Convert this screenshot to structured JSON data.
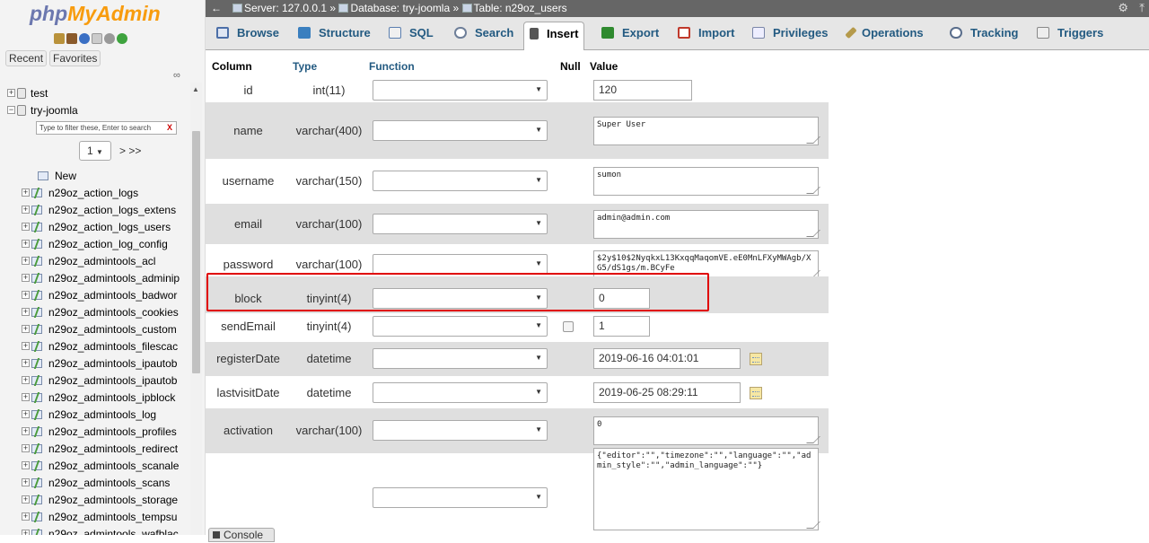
{
  "nav": {
    "logo_a": "php",
    "logo_b": "MyAdmin",
    "recent": "Recent",
    "favorites": "Favorites",
    "filter_placeholder": "Type to filter these, Enter to search",
    "filter_clear": "X",
    "page_value": "1",
    "page_next": "> >>",
    "new_label": "New",
    "databases": [
      "test",
      "try-joomla"
    ],
    "tables": [
      "n29oz_action_logs",
      "n29oz_action_logs_extens",
      "n29oz_action_logs_users",
      "n29oz_action_log_config",
      "n29oz_admintools_acl",
      "n29oz_admintools_adminip",
      "n29oz_admintools_badwor",
      "n29oz_admintools_cookies",
      "n29oz_admintools_custom",
      "n29oz_admintools_filescac",
      "n29oz_admintools_ipautob",
      "n29oz_admintools_ipautob",
      "n29oz_admintools_ipblock",
      "n29oz_admintools_log",
      "n29oz_admintools_profiles",
      "n29oz_admintools_redirect",
      "n29oz_admintools_scanale",
      "n29oz_admintools_scans",
      "n29oz_admintools_storage",
      "n29oz_admintools_tempsu",
      "n29oz_admintools_wafblac"
    ]
  },
  "topbar": {
    "back": "←",
    "server": "Server: 127.0.0.1",
    "sep": "»",
    "database": "Database: try-joomla",
    "table": "Table: n29oz_users"
  },
  "tabs": [
    {
      "label": "Browse",
      "color": "#4c6fa8"
    },
    {
      "label": "Structure",
      "color": "#3a7fbf"
    },
    {
      "label": "SQL",
      "color": "#5b7fb0"
    },
    {
      "label": "Search",
      "color": "#6e7f99"
    },
    {
      "label": "Insert",
      "color": "#333333"
    },
    {
      "label": "Export",
      "color": "#2f8a2f"
    },
    {
      "label": "Import",
      "color": "#c0392b"
    },
    {
      "label": "Privileges",
      "color": "#7a86a8"
    },
    {
      "label": "Operations",
      "color": "#b59a4b"
    },
    {
      "label": "Tracking",
      "color": "#5a6e8c"
    },
    {
      "label": "Triggers",
      "color": "#888888"
    }
  ],
  "form": {
    "headers": {
      "column": "Column",
      "type": "Type",
      "function": "Function",
      "null": "Null",
      "value": "Value"
    },
    "rows": [
      {
        "column": "id",
        "type": "int(11)",
        "value": "120"
      },
      {
        "column": "name",
        "type": "varchar(400)",
        "value": "Super User"
      },
      {
        "column": "username",
        "type": "varchar(150)",
        "value": "sumon"
      },
      {
        "column": "email",
        "type": "varchar(100)",
        "value": "admin@admin.com"
      },
      {
        "column": "password",
        "type": "varchar(100)",
        "value": "$2y$10$2NyqkxL13KxqqMaqomVE.eE0MnLFXyMWAgb/XG5/dS1gs/m.BCyFe"
      },
      {
        "column": "block",
        "type": "tinyint(4)",
        "value": "0"
      },
      {
        "column": "sendEmail",
        "type": "tinyint(4)",
        "value": "1"
      },
      {
        "column": "registerDate",
        "type": "datetime",
        "value": "2019-06-16 04:01:01"
      },
      {
        "column": "lastvisitDate",
        "type": "datetime",
        "value": "2019-06-25 08:29:11"
      },
      {
        "column": "activation",
        "type": "varchar(100)",
        "value": "0"
      },
      {
        "column": "",
        "type": "",
        "value": "{\"editor\":\"\",\"timezone\":\"\",\"language\":\"\",\"admin_style\":\"\",\"admin_language\":\"\"}"
      }
    ]
  },
  "console": {
    "label": "Console"
  }
}
